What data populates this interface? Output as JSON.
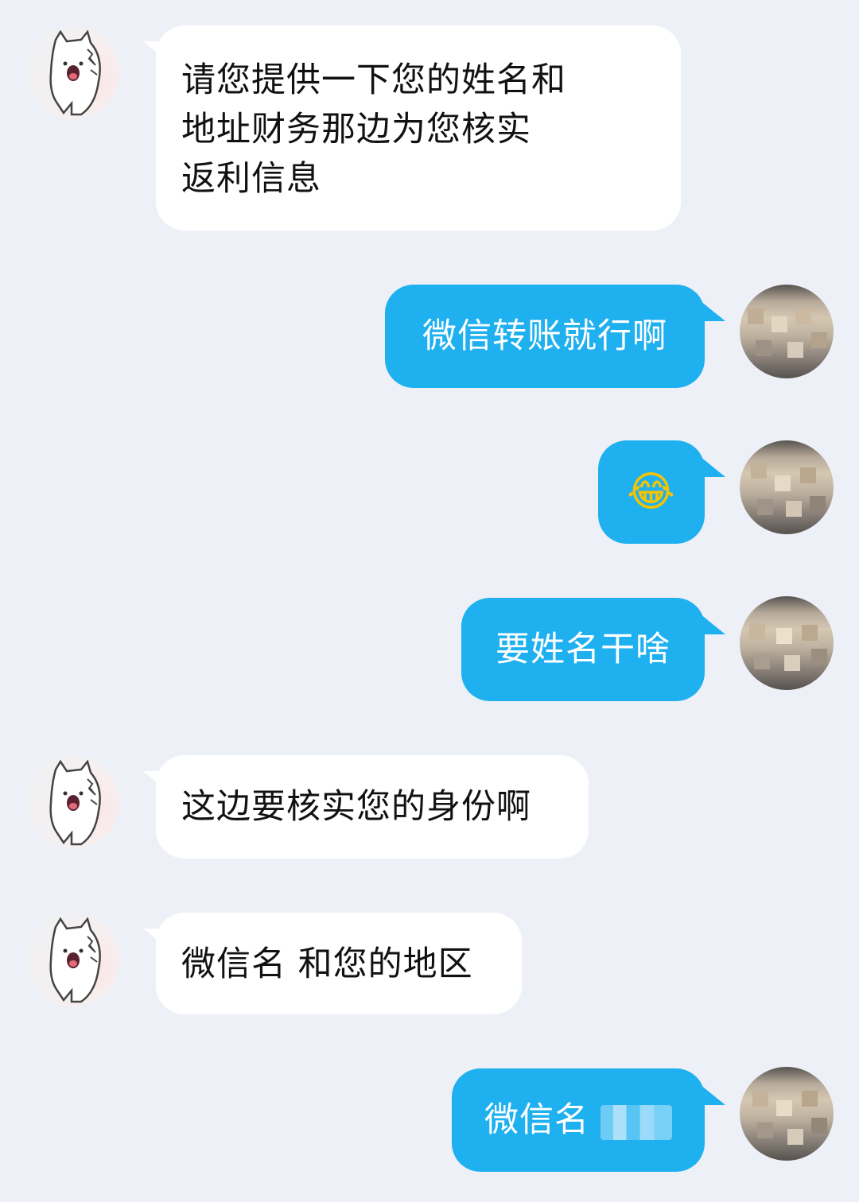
{
  "messages": [
    {
      "side": "in",
      "lines": [
        "请您提供一下您的姓名和",
        "地址财务那边为您核实",
        "返利信息"
      ]
    },
    {
      "side": "out",
      "text": "微信转账就行啊"
    },
    {
      "side": "out",
      "emoji": "😂",
      "icon": "tears-of-joy-emoji"
    },
    {
      "side": "out",
      "text": "要姓名干啥"
    },
    {
      "side": "in",
      "text": "这边要核实您的身份啊"
    },
    {
      "side": "in",
      "text": "微信名 和您的地区"
    },
    {
      "side": "out",
      "text": "微信名"
    }
  ],
  "colors": {
    "background": "#eef0f7",
    "incoming_bubble": "#ffffff",
    "outgoing_bubble": "#1fb0f0",
    "incoming_text": "#111111",
    "outgoing_text": "#ffffff"
  }
}
